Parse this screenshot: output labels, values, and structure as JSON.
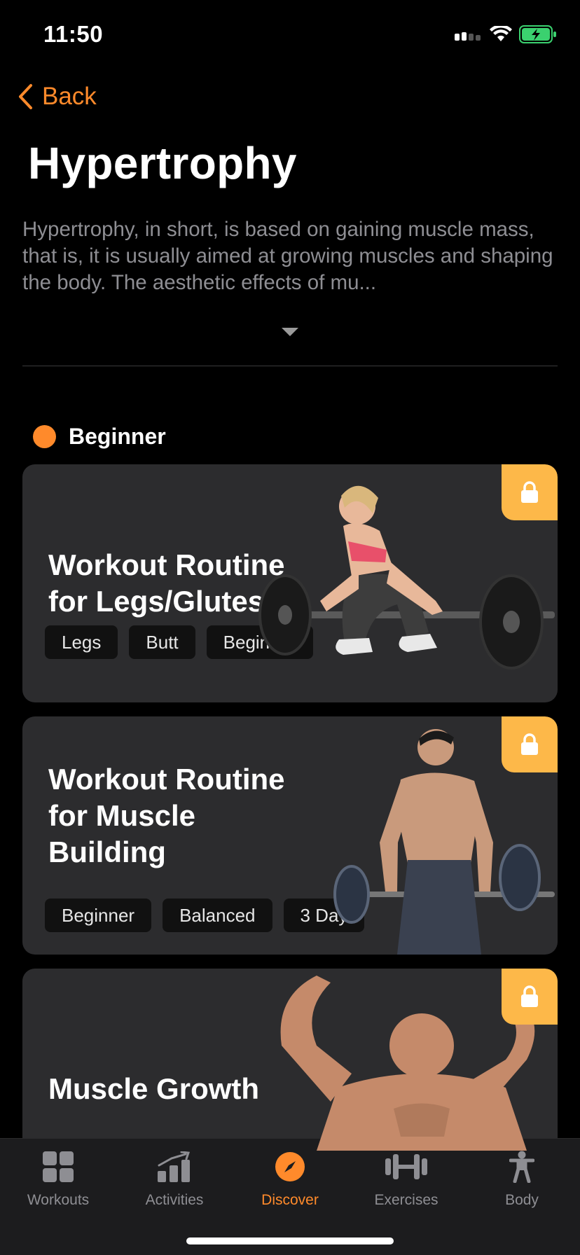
{
  "status": {
    "time": "11:50"
  },
  "nav": {
    "back_label": "Back"
  },
  "page": {
    "title": "Hypertrophy",
    "description": "Hypertrophy, in short, is based on gaining muscle mass, that is, it is usually aimed at growing muscles and shaping the body. The aesthetic effects of mu..."
  },
  "section": {
    "title": "Beginner",
    "accent": "#ff8a2b"
  },
  "cards": [
    {
      "title_line1": "Workout Routine",
      "title_line2": "for Legs/Glutes",
      "tags": [
        "Legs",
        "Butt",
        "Beginner"
      ]
    },
    {
      "title_line1": "Workout Routine",
      "title_line2": "for Muscle",
      "title_line3": "Building",
      "tags": [
        "Beginner",
        "Balanced",
        "3 Day"
      ]
    },
    {
      "title_line1": "Muscle Growth"
    }
  ],
  "tabbar": {
    "tabs": [
      {
        "label": "Workouts",
        "icon": "grid-icon"
      },
      {
        "label": "Activities",
        "icon": "chart-icon"
      },
      {
        "label": "Discover",
        "icon": "compass-icon",
        "active": true
      },
      {
        "label": "Exercises",
        "icon": "dumbbell-icon"
      },
      {
        "label": "Body",
        "icon": "person-icon"
      }
    ]
  },
  "colors": {
    "accent": "#ff8a2b",
    "lock_badge": "#fdb849",
    "card_bg": "#2c2c2e"
  }
}
